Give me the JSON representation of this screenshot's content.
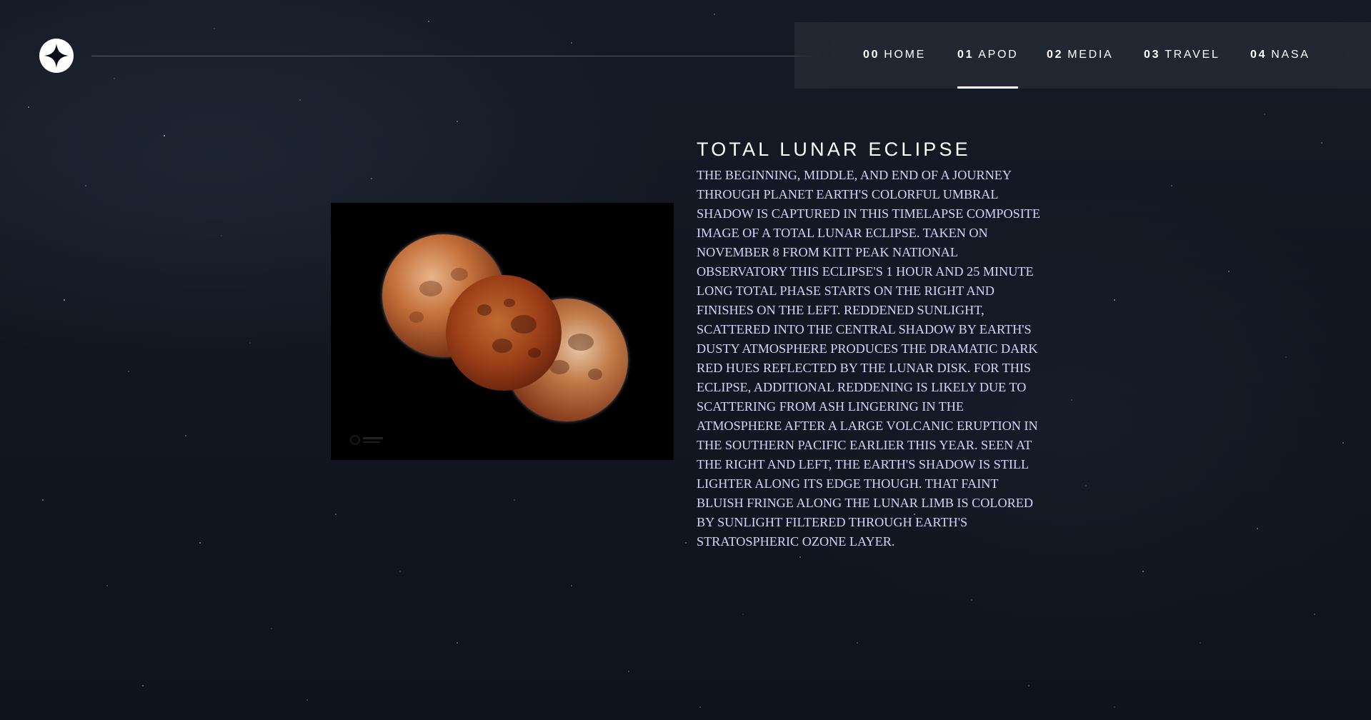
{
  "header": {
    "logo_icon": "star-logo-icon",
    "nav": [
      {
        "num": "00",
        "label": "HOME",
        "active": false
      },
      {
        "num": "01",
        "label": "APOD",
        "active": true
      },
      {
        "num": "02",
        "label": "MEDIA",
        "active": false
      },
      {
        "num": "03",
        "label": "TRAVEL",
        "active": false
      },
      {
        "num": "04",
        "label": "NASA",
        "active": false
      }
    ]
  },
  "apod": {
    "title": "TOTAL LUNAR ECLIPSE",
    "image_alt": "Timelapse composite of three eclipsed moons",
    "image_watermark": "",
    "description": "The beginning, middle, and end of a journey through planet Earth's colorful umbral shadow is captured in this timelapse composite image of a total lunar eclipse. Taken on November 8 from Kitt Peak National Observatory this eclipse's 1 hour and 25 minute long total phase starts on the right and finishes on the left. Reddened sunlight, scattered into the central shadow by Earth's dusty atmosphere produces the dramatic dark red hues reflected by the lunar disk. For this eclipse, additional reddening is likely due to scattering from ash lingering in the atmosphere after a large volcanic eruption in the southern Pacific earlier this year. Seen at the right and left, the Earth's shadow is still lighter along its edge though. That faint bluish fringe along the lunar limb is colored by sunlight filtered through Earth's stratospheric ozone layer."
  },
  "colors": {
    "background": "#0b0d17",
    "text_primary": "#ffffff",
    "text_secondary": "#d0d6f9",
    "moon_red": "#7a2a10",
    "moon_orange": "#c0622a"
  }
}
